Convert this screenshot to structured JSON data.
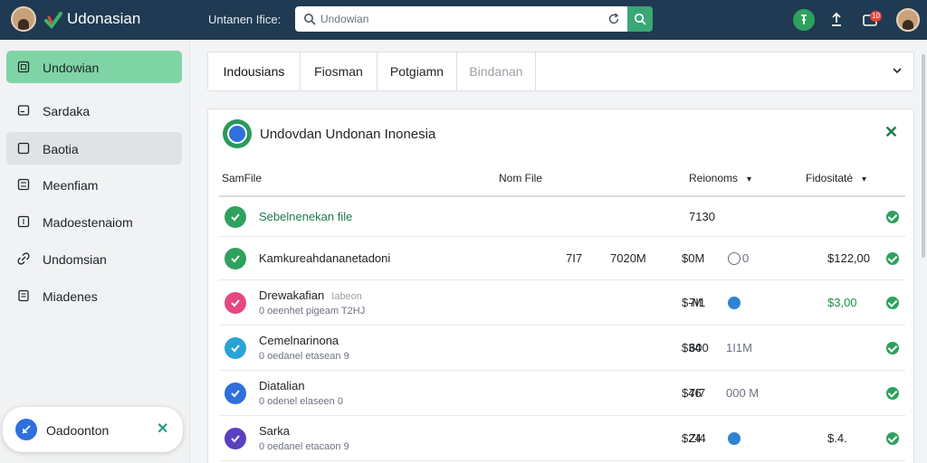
{
  "topbar": {
    "brand": "Udonasian",
    "search_label": "Untanen Ifice:",
    "search_value": "Undowian",
    "badge": "10",
    "colors": {
      "bar": "#1f3a52",
      "accent": "#3aa776"
    }
  },
  "sidebar": {
    "items": [
      {
        "label": "Undowian",
        "icon": "square-icon"
      },
      {
        "label": "Sardaka",
        "icon": "card-icon"
      },
      {
        "label": "Baotia",
        "icon": "square-icon"
      },
      {
        "label": "Meenfiam",
        "icon": "grid-icon"
      },
      {
        "label": "Madoestenaiom",
        "icon": "list-icon"
      },
      {
        "label": "Undomsian",
        "icon": "link-icon"
      },
      {
        "label": "Miadenes",
        "icon": "doc-icon"
      }
    ],
    "floating": {
      "label": "Oadoonton"
    }
  },
  "tabs": [
    {
      "label": "Indousians",
      "state": "active"
    },
    {
      "label": "Fiosman",
      "state": "normal"
    },
    {
      "label": "Potgiamn",
      "state": "normal"
    },
    {
      "label": "Bindanan",
      "state": "disabled"
    }
  ],
  "panel": {
    "title": "Undovdan Undonan Inonesia",
    "columns": [
      "SamFile",
      "Nom File",
      "Reionoms",
      "Fidositaté"
    ],
    "rows": [
      {
        "title": "Sebelnenekan file",
        "sub": "",
        "tag": "",
        "icon_color": "#2ea15e",
        "title_color": "#1f7a4f",
        "c1": "",
        "c2": "",
        "c3": "",
        "c4": "7130",
        "c5": "",
        "amount": "",
        "amount_green": false,
        "has_dot": false,
        "dot_color": ""
      },
      {
        "title": "Kamkureahdananetadoni",
        "sub": "",
        "tag": "",
        "icon_color": "#2ea15e",
        "title_color": "#202428",
        "c1": "7I7",
        "c2": "7020M",
        "c3": "$0M",
        "c4": "",
        "c5": "0 ",
        "amount": "$122,00",
        "amount_green": false,
        "has_dot": true,
        "dot_color": "#ffffff"
      },
      {
        "title": "Drewakafian",
        "sub": "0 oeenhet pigeam   T2HJ",
        "tag": "Iabeon",
        "icon_color": "#e64882",
        "title_color": "#202428",
        "c1": "",
        "c2": "",
        "c3": "$-M",
        "c4": "7I1",
        "c5": "",
        "amount": "$3,00",
        "amount_green": true,
        "has_dot": true,
        "dot_color": "#2f83d0"
      },
      {
        "title": "Cemelnarinona",
        "sub": "0 oedanel etasean   9",
        "tag": "",
        "icon_color": "#2aa3d6",
        "title_color": "#202428",
        "c1": "",
        "c2": "",
        "c3": "$34",
        "c4": "600",
        "c5": "1I1M",
        "amount": "",
        "amount_green": false,
        "has_dot": false,
        "dot_color": ""
      },
      {
        "title": "Diatalian",
        "sub": "0 odenel elaseen   0",
        "tag": "",
        "icon_color": "#2f6fde",
        "title_color": "#202428",
        "c1": "",
        "c2": "",
        "c3": "$46",
        "c4": "7I7",
        "c5": "000 M",
        "amount": "",
        "amount_green": false,
        "has_dot": false,
        "dot_color": ""
      },
      {
        "title": "Sarka",
        "sub": "0 oedanel etacaon   9",
        "tag": "",
        "icon_color": "#5a3fbf",
        "title_color": "#202428",
        "c1": "",
        "c2": "",
        "c3": "$24",
        "c4": "ZI4",
        "c5": "",
        "amount": "$.4.",
        "amount_green": false,
        "has_dot": true,
        "dot_color": "#2f83d0"
      }
    ]
  }
}
